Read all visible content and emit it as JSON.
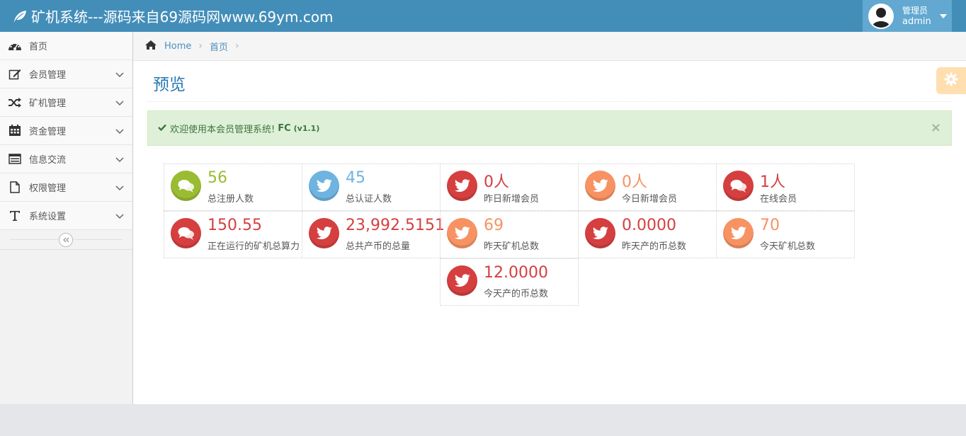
{
  "header": {
    "brand": "矿机系统---源码来自69源码网www.69ym.com",
    "user_role": "管理员",
    "user_name": "admin"
  },
  "sidebar": {
    "items": [
      {
        "label": "首页",
        "icon": "dashboard-icon",
        "has_submenu": false
      },
      {
        "label": "会员管理",
        "icon": "edit-icon",
        "has_submenu": true
      },
      {
        "label": "矿机管理",
        "icon": "random-icon",
        "has_submenu": true
      },
      {
        "label": "资金管理",
        "icon": "calendar-icon",
        "has_submenu": true
      },
      {
        "label": "信息交流",
        "icon": "list-icon",
        "has_submenu": true
      },
      {
        "label": "权限管理",
        "icon": "file-icon",
        "has_submenu": true
      },
      {
        "label": "系统设置",
        "icon": "text-icon",
        "has_submenu": true
      }
    ]
  },
  "breadcrumbs": {
    "home": "Home",
    "current": "首页"
  },
  "page": {
    "title": "预览"
  },
  "alert": {
    "text": "欢迎使用本会员管理系统!",
    "product": "FC",
    "version": "(v1.1)",
    "close": "×"
  },
  "colors": {
    "green": "#9abc32",
    "blue": "#6fb3e0",
    "red": "#d53f40",
    "orange": "#f79263",
    "header": "#438eb9"
  },
  "stats": [
    {
      "value": "56",
      "label": "总注册人数",
      "color": "green",
      "icon": "comments-icon"
    },
    {
      "value": "45",
      "label": "总认证人数",
      "color": "blue",
      "icon": "twitter-icon"
    },
    {
      "value": "0人",
      "label": "昨日新增会员",
      "color": "red",
      "icon": "twitter-icon"
    },
    {
      "value": "0人",
      "label": "今日新增会员",
      "color": "orange",
      "icon": "twitter-icon"
    },
    {
      "value": "1人",
      "label": "在线会员",
      "color": "red",
      "icon": "comments-icon"
    },
    {
      "value": "150.55",
      "label": "正在运行的矿机总算力",
      "color": "red",
      "icon": "comments-icon"
    },
    {
      "value": "23,992.5151",
      "label": "总共产币的总量",
      "color": "red",
      "icon": "twitter-icon"
    },
    {
      "value": "69",
      "label": "昨天矿机总数",
      "color": "orange",
      "icon": "twitter-icon"
    },
    {
      "value": "0.0000",
      "label": "昨天产的币总数",
      "color": "red",
      "icon": "twitter-icon"
    },
    {
      "value": "70",
      "label": "今天矿机总数",
      "color": "orange",
      "icon": "twitter-icon"
    },
    {
      "value": "12.0000",
      "label": "今天产的币总数",
      "color": "red",
      "icon": "twitter-icon"
    }
  ]
}
